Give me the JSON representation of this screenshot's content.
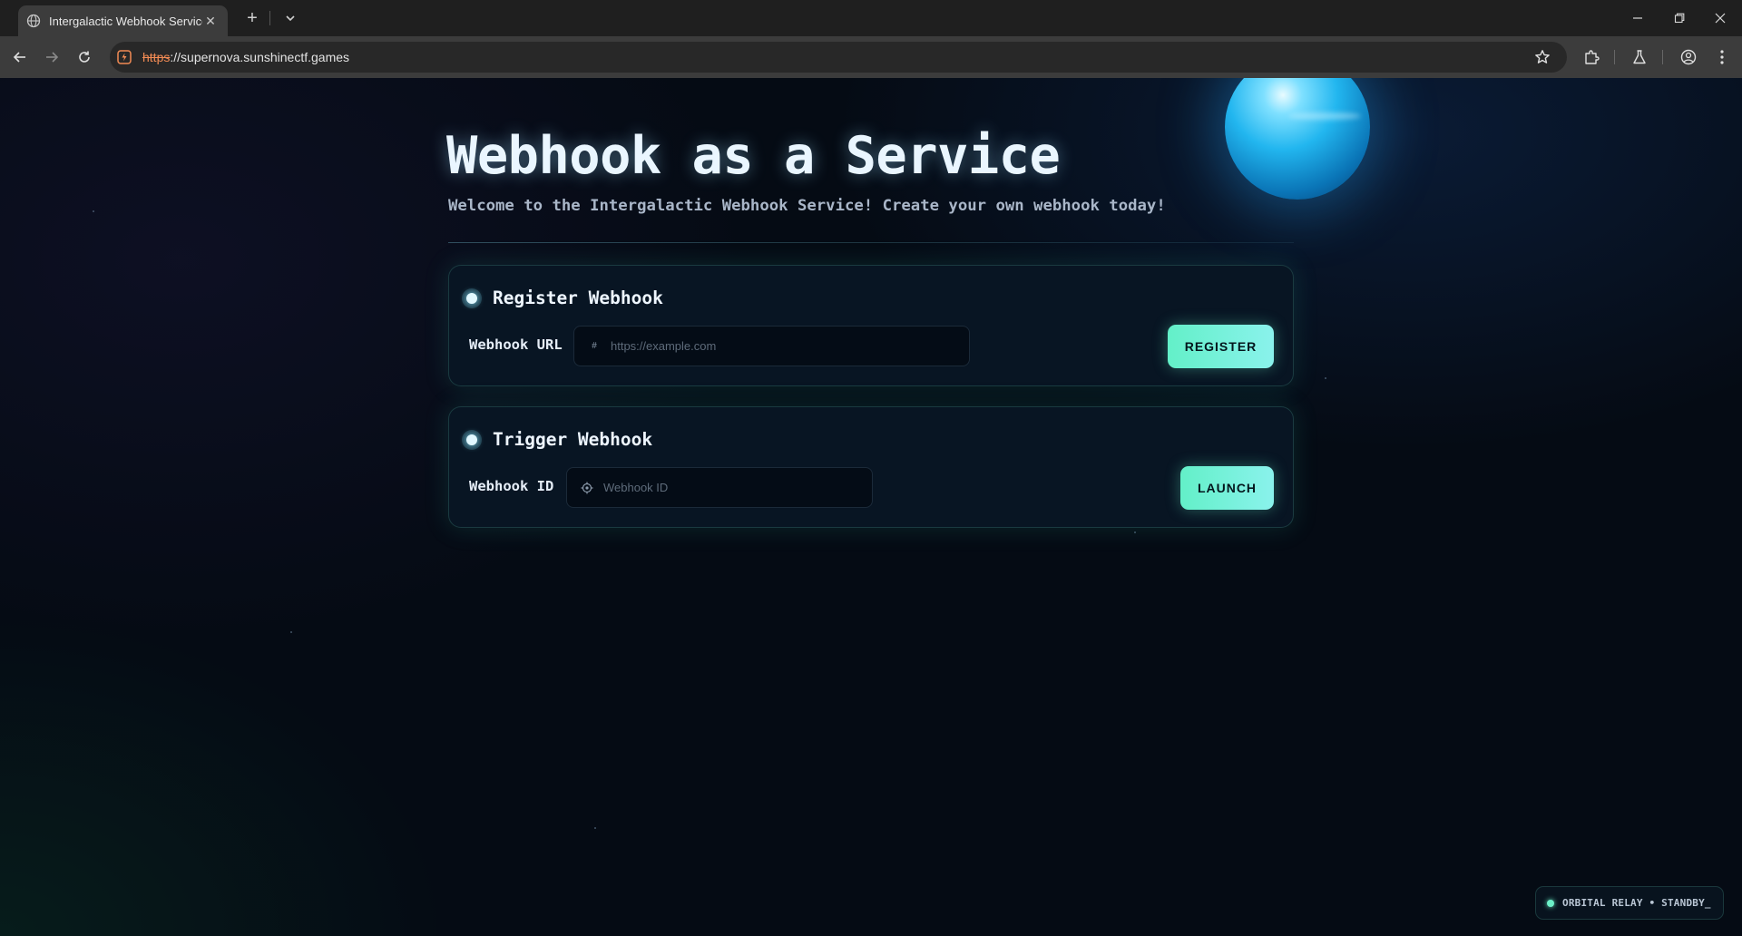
{
  "browser": {
    "tab_title": "Intergalactic Webhook Service",
    "tab_close_glyph": "✕",
    "new_tab_glyph": "+",
    "url_scheme": "https",
    "url_rest": "://supernova.sunshinectf.games"
  },
  "page": {
    "title": "Webhook as a Service",
    "subtitle": "Welcome to the Intergalactic Webhook Service! Create your own webhook today!"
  },
  "register": {
    "title": "Register Webhook",
    "field_label": "Webhook URL",
    "field_icon": "hash-icon",
    "field_icon_glyph": "#",
    "placeholder": "https://example.com",
    "value": "",
    "button_label": "REGISTER"
  },
  "trigger": {
    "title": "Trigger Webhook",
    "field_label": "Webhook ID",
    "field_icon": "target-icon",
    "placeholder": "Webhook ID",
    "value": "",
    "button_label": "LAUNCH"
  },
  "status": {
    "text": "ORBITAL RELAY • STANDBY_"
  },
  "colors": {
    "accent": "#63f0c8",
    "background": "#050b14",
    "card": "#081523",
    "planet": "#22b6ef",
    "url_scheme": "#f28b54"
  }
}
